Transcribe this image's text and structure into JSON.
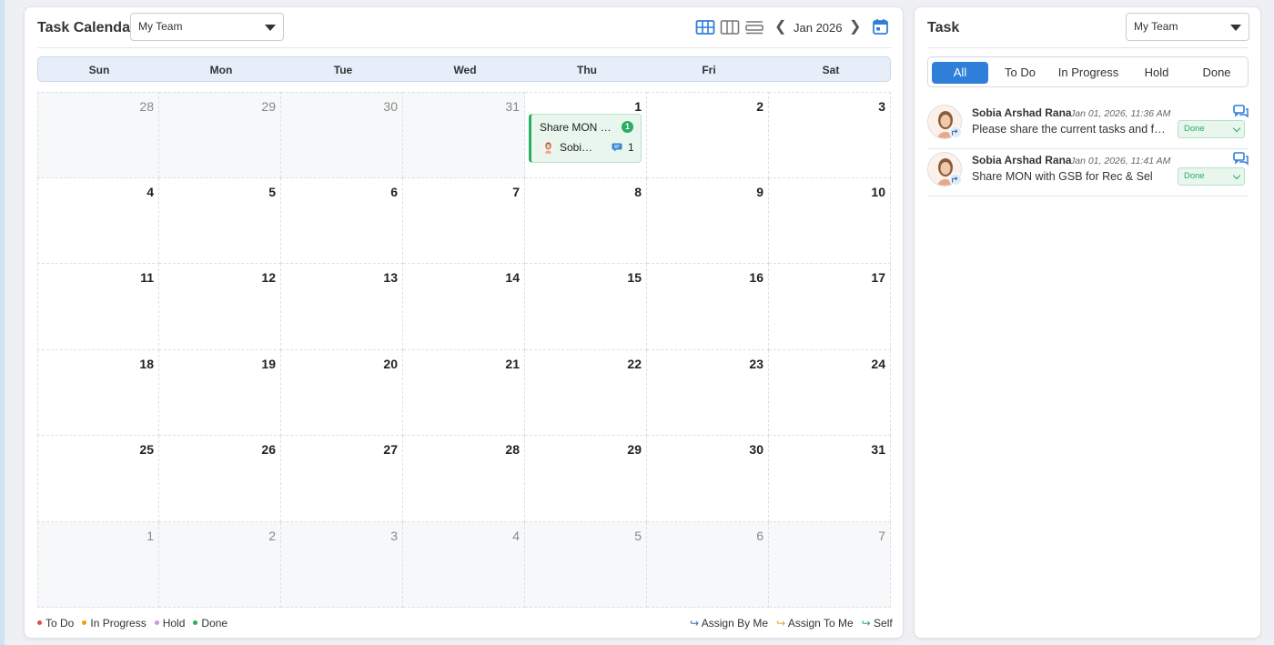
{
  "calendar": {
    "title": "Task Calendar",
    "team_select": "My Team",
    "month_label": "Jan 2026",
    "view_icons": [
      "month-grid-icon",
      "week-columns-icon",
      "list-rows-icon"
    ],
    "weekdays": [
      "Sun",
      "Mon",
      "Tue",
      "Wed",
      "Thu",
      "Fri",
      "Sat"
    ],
    "weeks": [
      [
        {
          "n": "28",
          "o": true
        },
        {
          "n": "29",
          "o": true
        },
        {
          "n": "30",
          "o": true
        },
        {
          "n": "31",
          "o": true
        },
        {
          "n": "1",
          "o": false
        },
        {
          "n": "2",
          "o": false
        },
        {
          "n": "3",
          "o": false
        }
      ],
      [
        {
          "n": "4",
          "o": false
        },
        {
          "n": "5",
          "o": false
        },
        {
          "n": "6",
          "o": false
        },
        {
          "n": "7",
          "o": false
        },
        {
          "n": "8",
          "o": false
        },
        {
          "n": "9",
          "o": false
        },
        {
          "n": "10",
          "o": false
        }
      ],
      [
        {
          "n": "11",
          "o": false
        },
        {
          "n": "12",
          "o": false
        },
        {
          "n": "13",
          "o": false
        },
        {
          "n": "14",
          "o": false
        },
        {
          "n": "15",
          "o": false
        },
        {
          "n": "16",
          "o": false
        },
        {
          "n": "17",
          "o": false
        }
      ],
      [
        {
          "n": "18",
          "o": false
        },
        {
          "n": "19",
          "o": false
        },
        {
          "n": "20",
          "o": false
        },
        {
          "n": "21",
          "o": false
        },
        {
          "n": "22",
          "o": false
        },
        {
          "n": "23",
          "o": false
        },
        {
          "n": "24",
          "o": false
        }
      ],
      [
        {
          "n": "25",
          "o": false
        },
        {
          "n": "26",
          "o": false
        },
        {
          "n": "27",
          "o": false
        },
        {
          "n": "28",
          "o": false
        },
        {
          "n": "29",
          "o": false
        },
        {
          "n": "30",
          "o": false
        },
        {
          "n": "31",
          "o": false
        }
      ],
      [
        {
          "n": "1",
          "o": true
        },
        {
          "n": "2",
          "o": true
        },
        {
          "n": "3",
          "o": true
        },
        {
          "n": "4",
          "o": true
        },
        {
          "n": "5",
          "o": true
        },
        {
          "n": "6",
          "o": true
        },
        {
          "n": "7",
          "o": true
        }
      ]
    ],
    "event": {
      "title": "Share MON …",
      "badge": "1",
      "user": "Sobi…",
      "comments": "1",
      "week": 0,
      "day": 4
    },
    "legend_status": [
      {
        "label": "To Do",
        "color": "#e74c3c"
      },
      {
        "label": "In Progress",
        "color": "#f39c12"
      },
      {
        "label": "Hold",
        "color": "#c39bd3"
      },
      {
        "label": "Done",
        "color": "#27ae60"
      }
    ],
    "legend_assign": [
      {
        "label": "Assign By Me",
        "icon": "assign-by-me-icon",
        "color": "#3a6fb0"
      },
      {
        "label": "Assign To Me",
        "icon": "assign-to-me-icon",
        "color": "#e8a33d"
      },
      {
        "label": "Self",
        "icon": "self-assign-icon",
        "color": "#27ae60"
      }
    ]
  },
  "task_panel": {
    "title": "Task",
    "team_select": "My Team",
    "tabs": [
      "All",
      "To Do",
      "In Progress",
      "Hold",
      "Done"
    ],
    "active_tab": "All",
    "items": [
      {
        "name": "Sobia Arshad Rana",
        "date": "Jan 01, 2026, 11:36 AM",
        "desc": "Please share the current tasks and future tasks",
        "status": "Done"
      },
      {
        "name": "Sobia Arshad Rana",
        "date": "Jan 01, 2026, 11:41 AM",
        "desc": "Share MON with GSB for Rec & Sel",
        "status": "Done"
      }
    ]
  },
  "colors": {
    "accent": "#2f7fd8",
    "done": "#27ae60"
  }
}
